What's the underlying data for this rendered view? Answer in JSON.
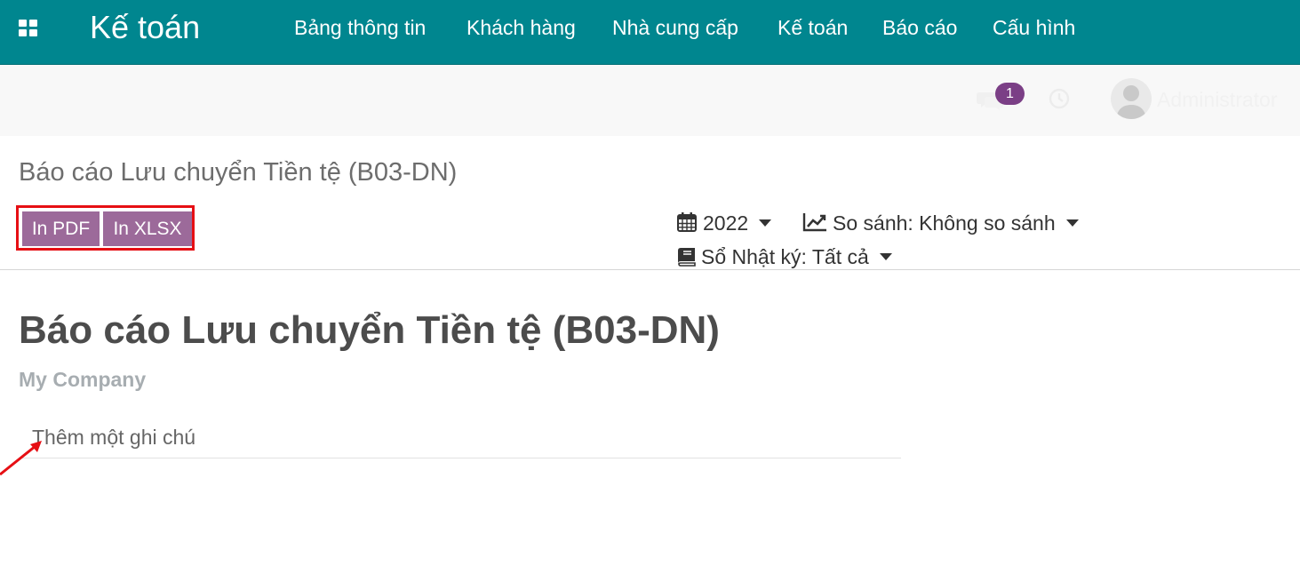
{
  "navbar": {
    "app_title": "Kế toán",
    "menu": [
      {
        "label": "Bảng thông tin"
      },
      {
        "label": "Khách hàng"
      },
      {
        "label": "Nhà cung cấp"
      },
      {
        "label": "Kế toán"
      },
      {
        "label": "Báo cáo"
      },
      {
        "label": "Cấu hình"
      }
    ]
  },
  "topbar": {
    "messages_count": "1",
    "user_name": "Administrator"
  },
  "breadcrumb": "Báo cáo Lưu chuyển Tiền tệ (B03-DN)",
  "buttons": {
    "print_pdf": "In PDF",
    "print_xlsx": "In XLSX"
  },
  "filters": {
    "period": "2022",
    "comparison": "So sánh: Không so sánh",
    "journals": "Sổ Nhật ký: Tất cả"
  },
  "report": {
    "title": "Báo cáo Lưu chuyển Tiền tệ (B03-DN)",
    "company": "My Company",
    "note_placeholder": "Thêm một ghi chú"
  },
  "colors": {
    "navbar": "#00868f",
    "button": "#9c6a9a",
    "highlight": "#e60f14",
    "badge": "#7b3f86"
  },
  "icons": [
    "apps-grid-icon",
    "chat-icon",
    "clock-icon",
    "user-avatar",
    "calendar-icon",
    "line-chart-icon",
    "book-icon",
    "chevron-down-icon"
  ]
}
